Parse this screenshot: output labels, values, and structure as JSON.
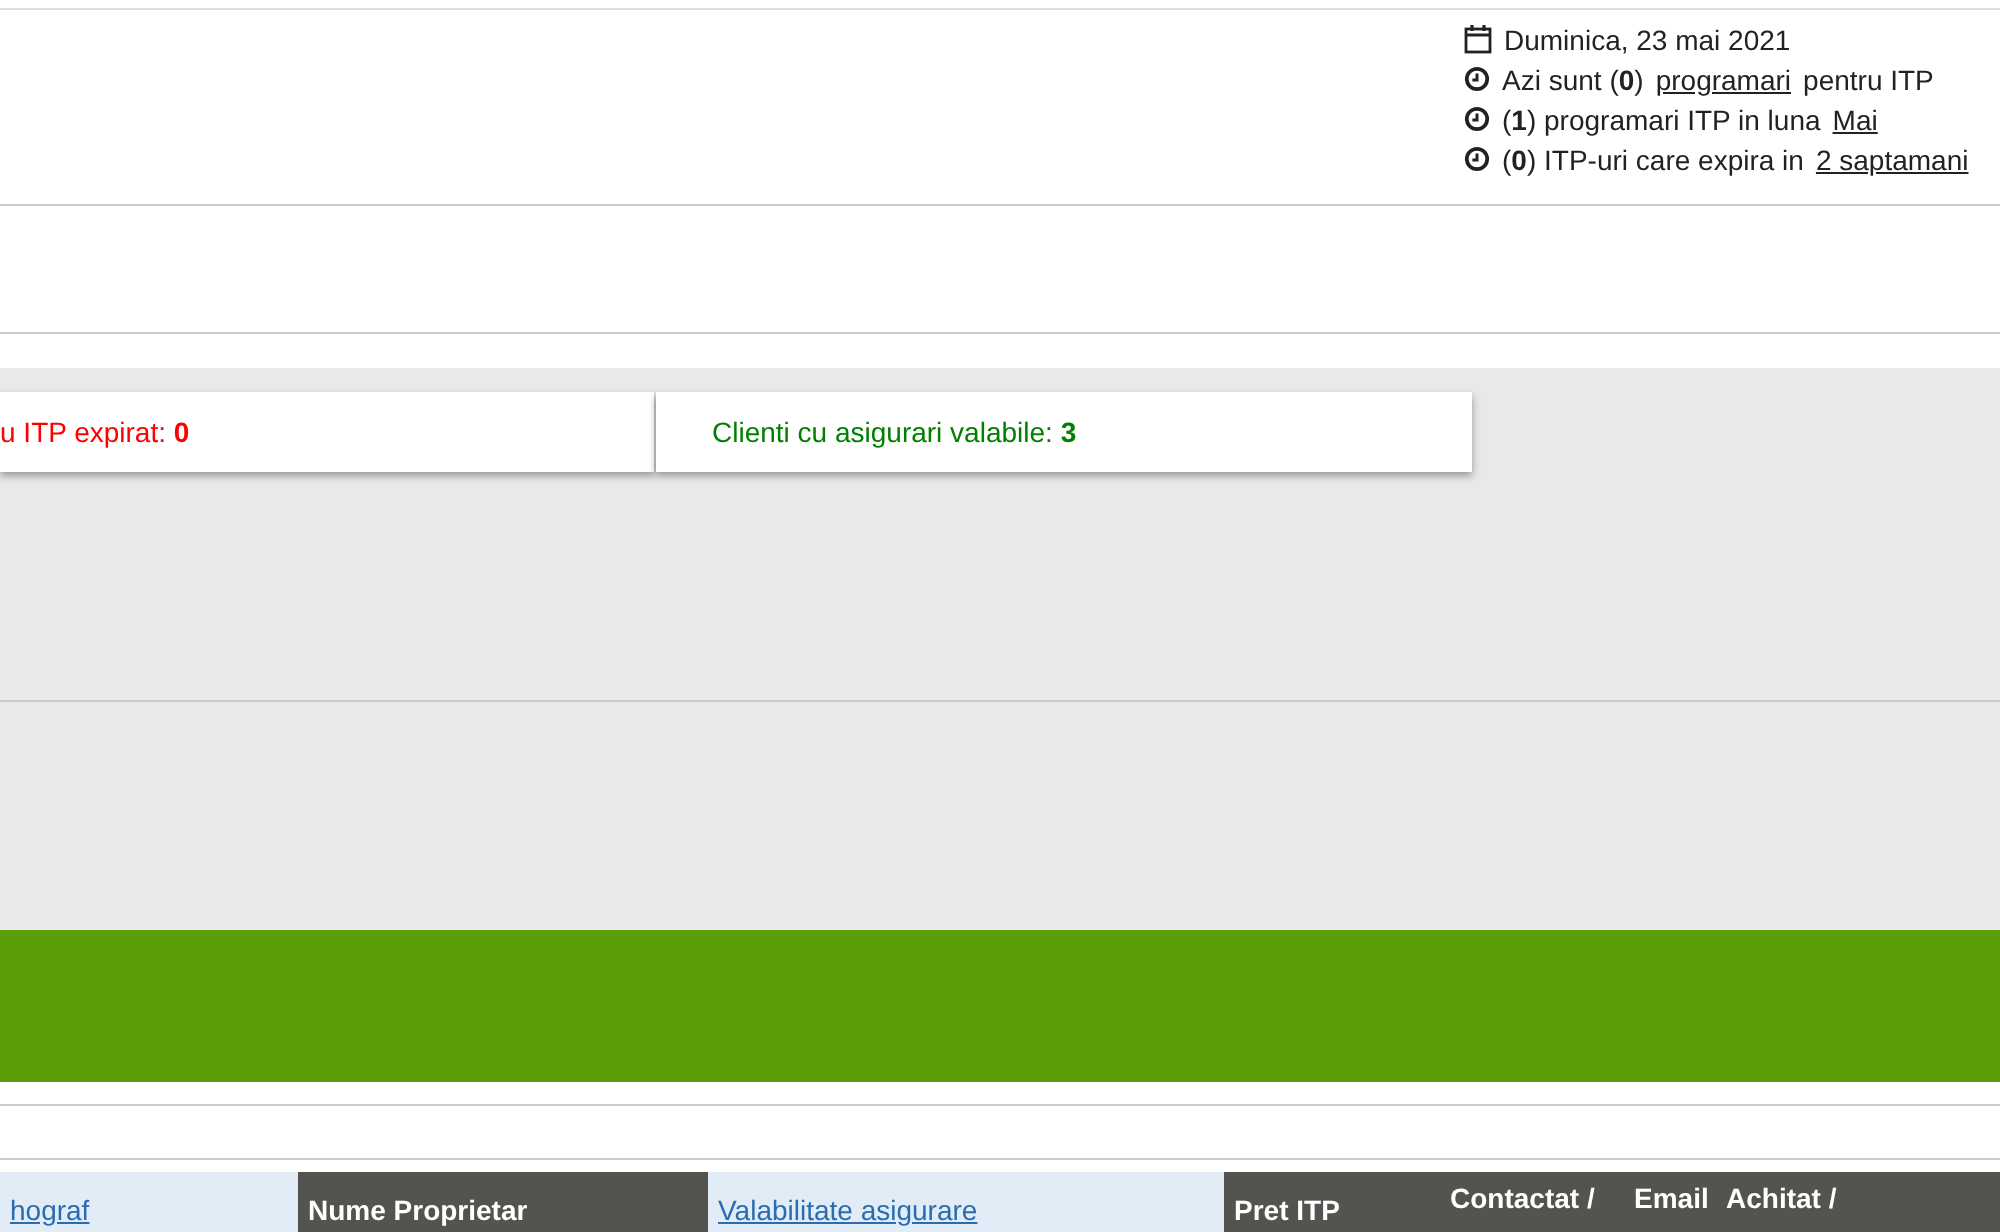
{
  "info": {
    "date": "Duminica, 23 mai 2021",
    "lines": [
      {
        "parts": [
          {
            "kind": "text",
            "text": "Azi sunt (**0**)"
          },
          {
            "kind": "link",
            "text": "programari"
          },
          {
            "kind": "text",
            "text": "pentru ITP"
          }
        ]
      },
      {
        "parts": [
          {
            "kind": "text",
            "text": "(**1**) programari ITP in luna"
          },
          {
            "kind": "link",
            "text": "Mai"
          }
        ]
      },
      {
        "parts": [
          {
            "kind": "text",
            "text": "(**0**) ITP-uri care expira in"
          },
          {
            "kind": "link",
            "text": "2 saptamani"
          }
        ]
      }
    ]
  },
  "stats": [
    {
      "label": "u ITP expirat:",
      "value": "0",
      "color": "#ff0000"
    },
    {
      "label": "Clienti cu asigurari valabile:",
      "value": "3",
      "color": "#008000"
    }
  ],
  "table": {
    "columns": [
      {
        "label": "hograf",
        "sortable": true
      },
      {
        "label": "Nume Proprietar",
        "sortable": false
      },
      {
        "label": "Valabilitate asigurare",
        "sortable": true
      },
      {
        "label": "Pret ITP",
        "sortable": false
      },
      {
        "label": "Contactat /",
        "sortable": false
      },
      {
        "label": "Email",
        "sortable": false
      },
      {
        "label": "Achitat /",
        "sortable": false
      }
    ]
  }
}
